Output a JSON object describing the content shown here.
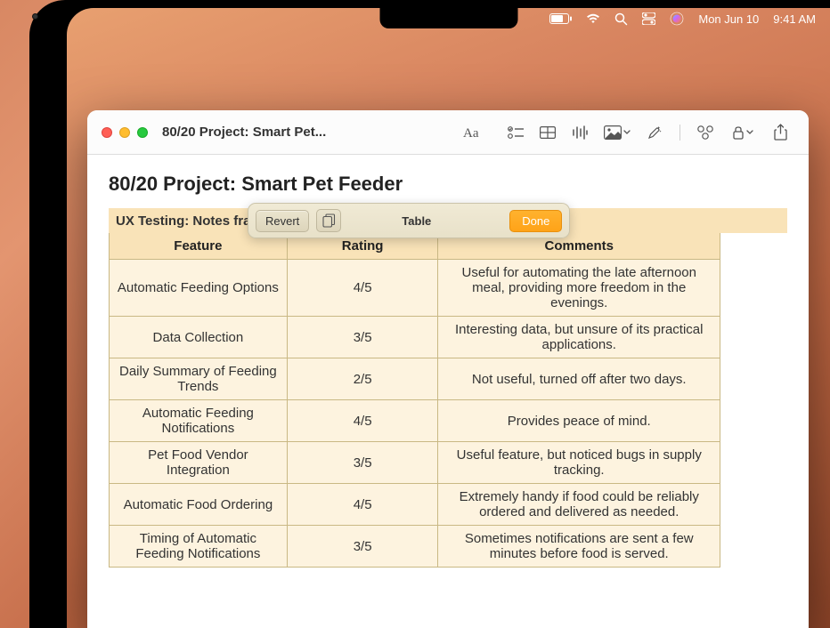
{
  "menubar": {
    "date": "Mon Jun 10",
    "time": "9:41 AM"
  },
  "window": {
    "title": "80/20 Project: Smart Pet..."
  },
  "note": {
    "title": "80/20 Project: Smart Pet Feeder",
    "subtitle": "UX Testing: Notes fra"
  },
  "float_toolbar": {
    "revert": "Revert",
    "label": "Table",
    "done": "Done"
  },
  "table": {
    "headers": {
      "feature": "Feature",
      "rating": "Rating",
      "comments": "Comments"
    },
    "rows": [
      {
        "feature": "Automatic Feeding Options",
        "rating": "4/5",
        "comments": "Useful for automating the late afternoon meal, providing more freedom in the evenings."
      },
      {
        "feature": "Data Collection",
        "rating": "3/5",
        "comments": "Interesting data, but unsure of its practical applications."
      },
      {
        "feature": "Daily Summary of Feeding Trends",
        "rating": "2/5",
        "comments": "Not useful, turned off after two days."
      },
      {
        "feature": "Automatic Feeding Notifications",
        "rating": "4/5",
        "comments": "Provides peace of mind."
      },
      {
        "feature": "Pet Food Vendor Integration",
        "rating": "3/5",
        "comments": "Useful feature, but noticed bugs in supply tracking."
      },
      {
        "feature": "Automatic Food Ordering",
        "rating": "4/5",
        "comments": "Extremely handy if food could be reliably ordered and delivered as needed."
      },
      {
        "feature": "Timing of Automatic Feeding Notifications",
        "rating": "3/5",
        "comments": "Sometimes notifications are sent a few minutes before food is served."
      }
    ]
  }
}
